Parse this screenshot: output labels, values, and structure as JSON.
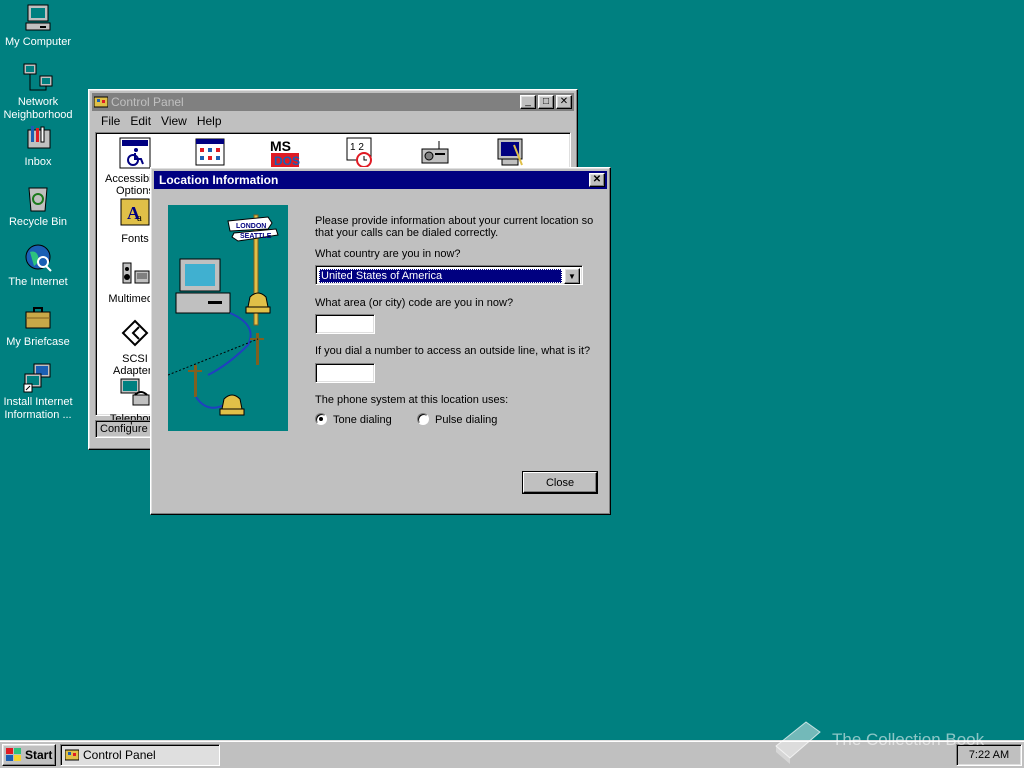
{
  "desktop": {
    "icons": [
      {
        "label": "My Computer",
        "icon": "computer-icon"
      },
      {
        "label": "Network Neighborhood",
        "icon": "network-icon"
      },
      {
        "label": "Inbox",
        "icon": "inbox-icon"
      },
      {
        "label": "Recycle Bin",
        "icon": "recycle-bin-icon"
      },
      {
        "label": "The Internet",
        "icon": "internet-globe-icon"
      },
      {
        "label": "My Briefcase",
        "icon": "briefcase-icon"
      },
      {
        "label": "Install Internet Information ...",
        "icon": "install-icon"
      }
    ]
  },
  "control_panel": {
    "title": "Control Panel",
    "menu": [
      "File",
      "Edit",
      "View",
      "Help"
    ],
    "items": [
      {
        "label": "Accessibility Options",
        "icon": "accessibility-icon"
      },
      {
        "label": "",
        "icon": "add-remove-programs-icon"
      },
      {
        "label": "",
        "icon": "msdos-icon"
      },
      {
        "label": "",
        "icon": "date-time-icon"
      },
      {
        "label": "",
        "icon": "device-icon"
      },
      {
        "label": "",
        "icon": "display-icon"
      },
      {
        "label": "Fonts",
        "icon": "fonts-icon"
      },
      {
        "label": "Multimedia",
        "icon": "multimedia-icon"
      },
      {
        "label": "SCSI Adapters",
        "icon": "scsi-icon"
      },
      {
        "label": "Telephony",
        "icon": "telephony-icon"
      }
    ],
    "status": "Configure T"
  },
  "dialog": {
    "title": "Location Information",
    "intro_line1": "Please provide information about your current location so",
    "intro_line2": "that your calls can be dialed correctly.",
    "country_label": "What country are you in now?",
    "country_value": "United States of America",
    "area_label": "What area (or city) code are you in now?",
    "area_value": "",
    "outside_label": "If you dial a number to access an outside line, what is it?",
    "outside_value": "",
    "phone_system_label": "The phone system at this location uses:",
    "tone_label": "Tone dialing",
    "pulse_label": "Pulse dialing",
    "selected_dialing": "tone",
    "close_button": "Close",
    "sign_text1": "LONDON",
    "sign_text2": "SEATTLE"
  },
  "taskbar": {
    "start_label": "Start",
    "task_label": "Control Panel",
    "clock": "7:22 AM"
  },
  "watermark": "The Collection Book"
}
